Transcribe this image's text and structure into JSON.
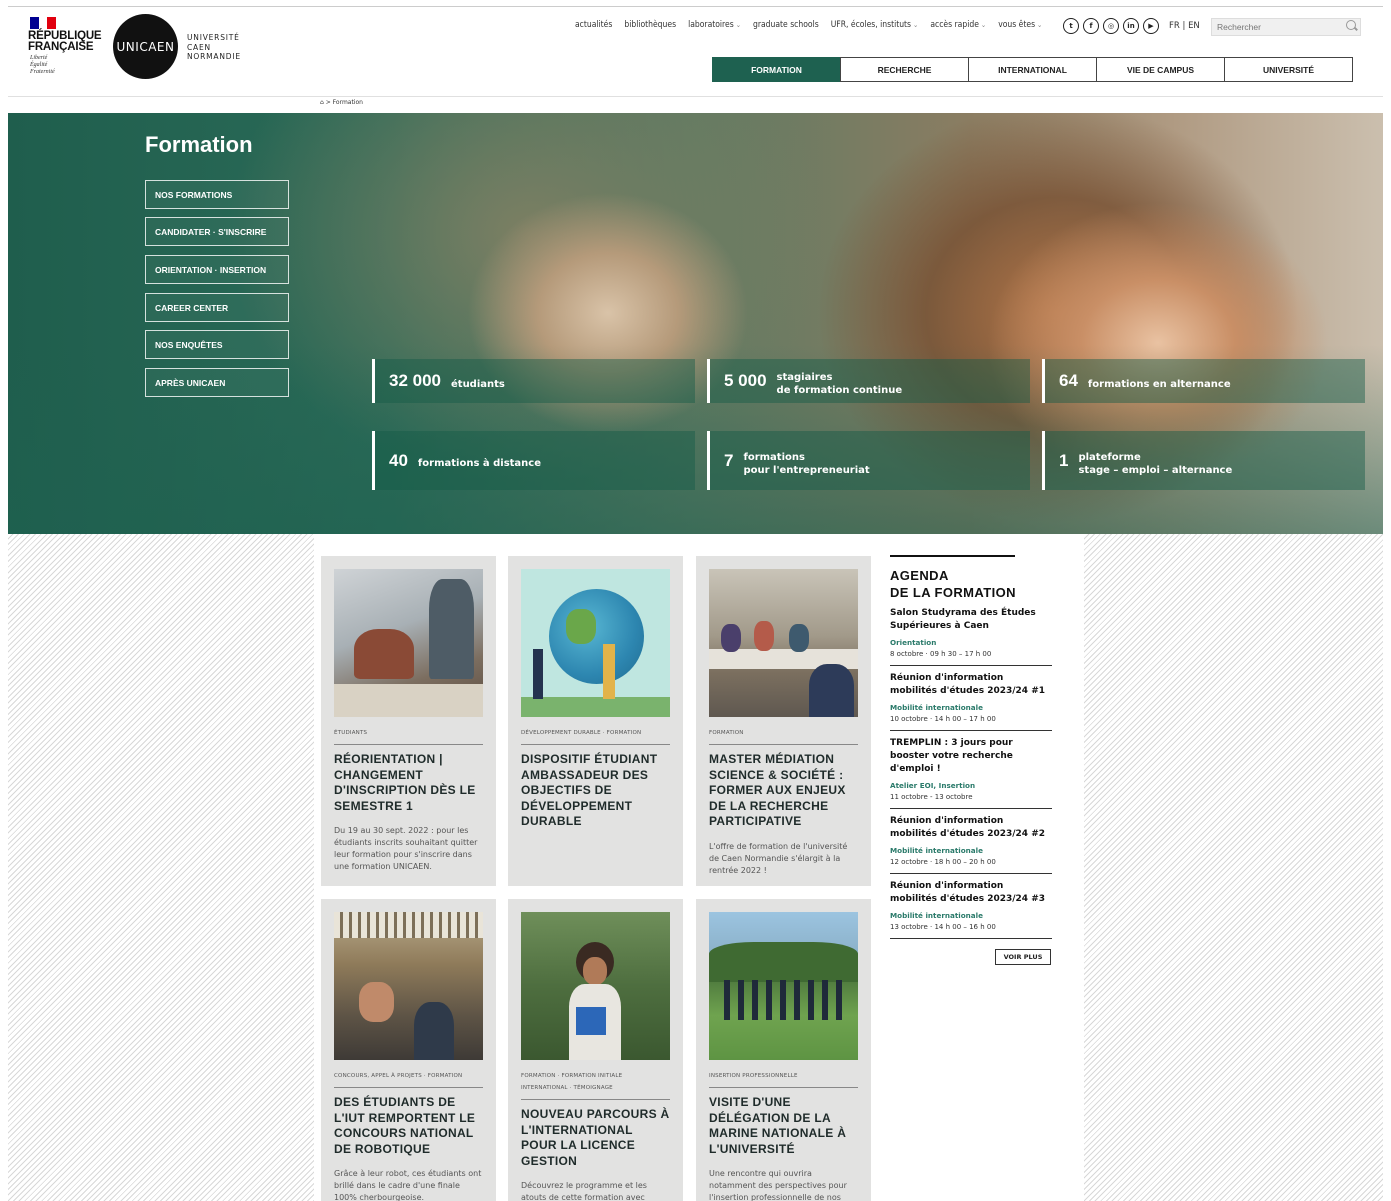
{
  "header": {
    "gov_text": "RÉPUBLIQUE\nFRANÇAISE",
    "gov_motto": "Liberté\nÉgalité\nFraternité",
    "logo_mark": "UNICAEN",
    "logo_text": "UNIVERSITÉ\nCAEN\nNORMANDIE",
    "util_nav": [
      {
        "label": "actualités",
        "dropdown": false
      },
      {
        "label": "bibliothèques",
        "dropdown": false
      },
      {
        "label": "laboratoires",
        "dropdown": true
      },
      {
        "label": "graduate schools",
        "dropdown": false
      },
      {
        "label": "UFR, écoles, instituts",
        "dropdown": true
      },
      {
        "label": "accès rapide",
        "dropdown": true
      },
      {
        "label": "vous êtes",
        "dropdown": true
      }
    ],
    "socials": [
      "twitter-icon",
      "facebook-icon",
      "instagram-icon",
      "linkedin-icon",
      "youtube-icon"
    ],
    "lang": "FR | EN",
    "search_placeholder": "Rechercher",
    "main_nav": [
      {
        "label": "FORMATION",
        "active": true
      },
      {
        "label": "RECHERCHE",
        "active": false
      },
      {
        "label": "INTERNATIONAL",
        "active": false
      },
      {
        "label": "VIE DE CAMPUS",
        "active": false
      },
      {
        "label": "UNIVERSITÉ",
        "active": false
      }
    ]
  },
  "breadcrumb": {
    "home_icon": "home-icon",
    "text": "> Formation"
  },
  "hero": {
    "title": "Formation",
    "buttons": [
      "NOS FORMATIONS",
      "CANDIDATER · S'INSCRIRE",
      "ORIENTATION · INSERTION",
      "CAREER CENTER",
      "NOS ENQUÊTES",
      "APRÈS UNICAEN"
    ],
    "stats": [
      {
        "num": "32 000",
        "label": "étudiants"
      },
      {
        "num": "5 000",
        "label": "stagiaires\nde formation continue"
      },
      {
        "num": "64",
        "label": "formations en alternance"
      },
      {
        "num": "40",
        "label": "formations à distance"
      },
      {
        "num": "7",
        "label": "formations\npour l'entrepreneuriat"
      },
      {
        "num": "1",
        "label": "plateforme\nstage – emploi – alternance"
      }
    ]
  },
  "cards": [
    {
      "category": "ÉTUDIANTS",
      "title": "RÉORIENTATION | CHANGEMENT D'INSCRIPTION DÈS LE SEMESTRE 1",
      "desc": "Du 19 au 30 sept. 2022 : pour les étudiants inscrits souhaitant quitter leur formation pour s'inscrire dans une formation UNICAEN."
    },
    {
      "category": "DÉVELOPPEMENT DURABLE · FORMATION",
      "title": "DISPOSITIF ÉTUDIANT AMBASSADEUR DES OBJECTIFS DE DÉVELOPPEMENT DURABLE",
      "desc": ""
    },
    {
      "category": "FORMATION",
      "title": "MASTER MÉDIATION SCIENCE & SOCIÉTÉ : FORMER AUX ENJEUX DE LA RECHERCHE PARTICIPATIVE",
      "desc": "L'offre de formation de l'université de Caen Normandie s'élargit à la rentrée 2022 !"
    },
    {
      "category": "CONCOURS, APPEL À PROJETS · FORMATION",
      "title": "DES ÉTUDIANTS DE L'IUT REMPORTENT LE CONCOURS NATIONAL DE ROBOTIQUE",
      "desc": "Grâce à leur robot, ces étudiants ont brillé dans le cadre d'une finale 100% cherbourgeoise."
    },
    {
      "category": "FORMATION · FORMATION INITIALE INTERNATIONAL · TÉMOIGNAGE",
      "title": "NOUVEAU PARCOURS À L'INTERNATIONAL POUR LA LICENCE GESTION",
      "desc": "Découvrez le programme et les atouts de cette formation avec Meriem Ben Salah - Saint Michel,"
    },
    {
      "category": "INSERTION PROFESSIONNELLE",
      "title": "VISITE D'UNE DÉLÉGATION DE LA MARINE NATIONALE À L'UNIVERSITÉ",
      "desc": "Une rencontre qui ouvrira notamment des perspectives pour l'insertion professionnelle de nos"
    }
  ],
  "agenda": {
    "title": "AGENDA\nDE LA FORMATION",
    "events": [
      {
        "title": "Salon Studyrama des Études Supérieures à Caen",
        "cat": "Orientation",
        "date": "8 octobre · 09 h 30 – 17 h 00"
      },
      {
        "title": "Réunion d'information mobilités d'études 2023/24 #1",
        "cat": "Mobilité internationale",
        "date": "10 octobre · 14 h 00 – 17 h 00"
      },
      {
        "title": "TREMPLIN : 3 jours pour booster votre recherche d'emploi !",
        "cat": "Atelier EOI, Insertion",
        "date": "11 octobre - 13 octobre"
      },
      {
        "title": "Réunion d'information mobilités d'études 2023/24 #2",
        "cat": "Mobilité internationale",
        "date": "12 octobre · 18 h 00 – 20 h 00"
      },
      {
        "title": "Réunion d'information mobilités d'études 2023/24 #3",
        "cat": "Mobilité internationale",
        "date": "13 octobre · 14 h 00 – 16 h 00"
      }
    ],
    "more": "VOIR PLUS"
  },
  "colors": {
    "brand_green": "#1e6150",
    "agenda_accent": "#2a7a6a"
  }
}
